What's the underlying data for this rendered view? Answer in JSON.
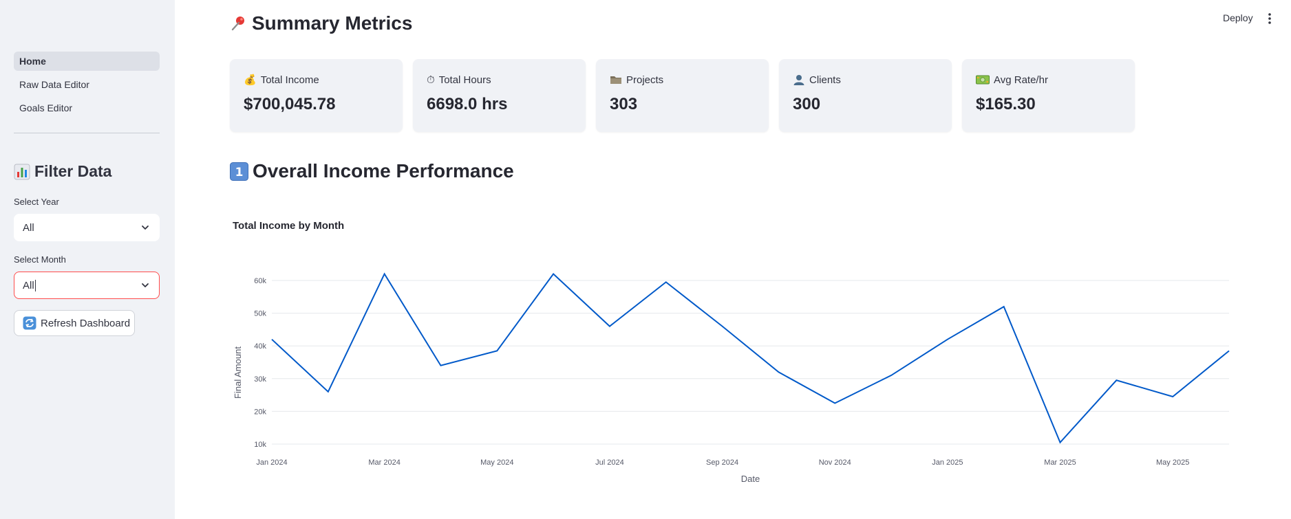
{
  "sidebar": {
    "nav": [
      {
        "label": "Home",
        "active": true
      },
      {
        "label": "Raw Data Editor",
        "active": false
      },
      {
        "label": "Goals Editor",
        "active": false
      }
    ],
    "filter_title": "Filter Data",
    "filter_icon": "bar-chart-emoji",
    "year": {
      "label": "Select Year",
      "value": "All"
    },
    "month": {
      "label": "Select Month",
      "value": "All"
    },
    "refresh_label": "Refresh Dashboard",
    "refresh_icon": "refresh-emoji"
  },
  "header": {
    "deploy_label": "Deploy"
  },
  "summary": {
    "title": "Summary Metrics",
    "title_icon": "pushpin-emoji",
    "metrics": [
      {
        "icon": "money-bag-emoji",
        "label": "Total Income",
        "value": "$700,045.78"
      },
      {
        "icon": "stopwatch-emoji",
        "label": "Total Hours",
        "value": "6698.0 hrs"
      },
      {
        "icon": "folder-emoji",
        "label": "Projects",
        "value": "303"
      },
      {
        "icon": "person-emoji",
        "label": "Clients",
        "value": "300"
      },
      {
        "icon": "dollar-banknote-emoji",
        "label": "Avg Rate/hr",
        "value": "$165.30"
      }
    ]
  },
  "performance": {
    "title": "Overall Income Performance",
    "title_icon": "keycap-1-emoji"
  },
  "colors": {
    "accent": "#ff4b4b",
    "line": "#0059c9",
    "sidebar_bg": "#f0f2f6"
  },
  "chart_data": {
    "type": "line",
    "title": "Total Income by Month",
    "xlabel": "Date",
    "ylabel": "Final Amount",
    "x": [
      "2024-01",
      "2024-02",
      "2024-03",
      "2024-04",
      "2024-05",
      "2024-06",
      "2024-07",
      "2024-08",
      "2024-09",
      "2024-10",
      "2024-11",
      "2024-12",
      "2025-01",
      "2025-02",
      "2025-03",
      "2025-04",
      "2025-05",
      "2025-06"
    ],
    "series": [
      {
        "values": [
          42000,
          26000,
          62000,
          34000,
          38500,
          62000,
          46000,
          59500,
          46000,
          32000,
          22500,
          31000,
          42000,
          52000,
          10500,
          29500,
          24500,
          38500
        ]
      }
    ],
    "x_tick_labels": [
      "Jan 2024",
      "Mar 2024",
      "May 2024",
      "Jul 2024",
      "Sep 2024",
      "Nov 2024",
      "Jan 2025",
      "Mar 2025",
      "May 2025"
    ],
    "x_tick_index": [
      0,
      2,
      4,
      6,
      8,
      10,
      12,
      14,
      16
    ],
    "y_ticks": [
      10000,
      20000,
      30000,
      40000,
      50000,
      60000
    ],
    "y_tick_labels": [
      "10k",
      "20k",
      "30k",
      "40k",
      "50k",
      "60k"
    ],
    "ylim": [
      10000,
      60000
    ],
    "grid": true,
    "line_color": "#0059c9"
  }
}
